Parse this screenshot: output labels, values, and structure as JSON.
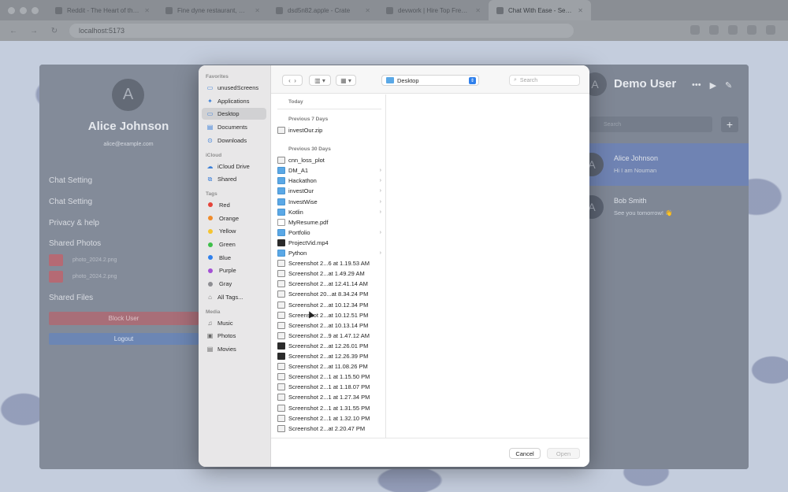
{
  "browser": {
    "tabs": [
      {
        "title": "Reddit - The Heart of the Internet",
        "active": false
      },
      {
        "title": "Fine dyne restaurant, mood",
        "active": false
      },
      {
        "title": "dsd5n82.apple - Crate",
        "active": false
      },
      {
        "title": "devwork | Hire Top Freelancer",
        "active": false
      },
      {
        "title": "Chat With Ease - Seamless",
        "active": true
      }
    ],
    "url": "localhost:5173"
  },
  "profile": {
    "avatar_letter": "A",
    "name": "Alice Johnson",
    "email": "alice@example.com",
    "menu": [
      "Chat Setting",
      "Chat Setting",
      "Privacy & help"
    ],
    "shared_photos_label": "Shared Photos",
    "photos": [
      "photo_2024.2.png",
      "photo_2024.2.png"
    ],
    "shared_files_label": "Shared Files",
    "block_label": "Block User",
    "logout_label": "Logout"
  },
  "chat": {
    "avatar_letter": "A",
    "title": "Demo User",
    "search_placeholder": "Search",
    "add_label": "+",
    "conversations": [
      {
        "avatar": "A",
        "name": "Alice Johnson",
        "message": "Hi I am Nouman",
        "selected": true
      },
      {
        "avatar": "A",
        "name": "Bob Smith",
        "message": "See you tomorrow! 👋",
        "selected": false
      }
    ]
  },
  "dialog": {
    "location": "Desktop",
    "search_placeholder": "Search",
    "sidebar": {
      "favorites_label": "Favorites",
      "favorites": [
        "unusedScreens",
        "Applications",
        "Desktop",
        "Documents",
        "Downloads"
      ],
      "selected": "Desktop",
      "icloud_label": "iCloud",
      "icloud": [
        "iCloud Drive",
        "Shared"
      ],
      "tags_label": "Tags",
      "tags": [
        {
          "name": "Red",
          "color": "#e5443a"
        },
        {
          "name": "Orange",
          "color": "#f08c2c"
        },
        {
          "name": "Yellow",
          "color": "#f5c531"
        },
        {
          "name": "Green",
          "color": "#3fbf4a"
        },
        {
          "name": "Blue",
          "color": "#2f80ec"
        },
        {
          "name": "Purple",
          "color": "#a450d4"
        },
        {
          "name": "Gray",
          "color": "#8e8e93"
        }
      ],
      "all_tags": "All Tags...",
      "media_label": "Media",
      "media": [
        "Music",
        "Photos",
        "Movies"
      ]
    },
    "groups": [
      {
        "label": "Today",
        "items": []
      },
      {
        "label": "Previous 7 Days",
        "items": [
          {
            "name": "investOur.zip",
            "kind": "zip"
          }
        ]
      },
      {
        "label": "Previous 30 Days",
        "items": [
          {
            "name": "cnn_loss_plot",
            "kind": "file"
          },
          {
            "name": "DM_A1",
            "kind": "dir"
          },
          {
            "name": "Hackathon",
            "kind": "dir"
          },
          {
            "name": "investOur",
            "kind": "dir"
          },
          {
            "name": "InvestWise",
            "kind": "dir"
          },
          {
            "name": "Kotlin",
            "kind": "dir"
          },
          {
            "name": "MyResume.pdf",
            "kind": "pdf"
          },
          {
            "name": "Portfolio",
            "kind": "dir"
          },
          {
            "name": "ProjectVid.mp4",
            "kind": "dark"
          },
          {
            "name": "Python",
            "kind": "dir"
          },
          {
            "name": "Screenshot 2...6 at 1.19.53 AM",
            "kind": "file"
          },
          {
            "name": "Screenshot 2...at 1.49.29 AM",
            "kind": "file"
          },
          {
            "name": "Screenshot 2...at 12.41.14 AM",
            "kind": "file"
          },
          {
            "name": "Screenshot 20...at 8.34.24 PM",
            "kind": "file"
          },
          {
            "name": "Screenshot 2...at 10.12.34 PM",
            "kind": "file"
          },
          {
            "name": "Screenshot 2...at 10.12.51 PM",
            "kind": "file"
          },
          {
            "name": "Screenshot 2...at 10.13.14 PM",
            "kind": "file"
          },
          {
            "name": "Screenshot 2...9 at 1.47.12 AM",
            "kind": "file"
          },
          {
            "name": "Screenshot 2...at 12.26.01 PM",
            "kind": "dark"
          },
          {
            "name": "Screenshot 2...at 12.26.39 PM",
            "kind": "dark"
          },
          {
            "name": "Screenshot 2...at 11.08.26 PM",
            "kind": "file"
          },
          {
            "name": "Screenshot 2...1 at 1.15.50 PM",
            "kind": "file"
          },
          {
            "name": "Screenshot 2...1 at 1.18.07 PM",
            "kind": "file"
          },
          {
            "name": "Screenshot 2...1 at 1.27.34 PM",
            "kind": "file"
          },
          {
            "name": "Screenshot 2...1 at 1.31.55 PM",
            "kind": "file"
          },
          {
            "name": "Screenshot 2...1 at 1.32.10 PM",
            "kind": "file"
          },
          {
            "name": "Screenshot 2...at 2.20.47 PM",
            "kind": "file"
          }
        ]
      }
    ],
    "cancel_label": "Cancel",
    "open_label": "Open"
  }
}
